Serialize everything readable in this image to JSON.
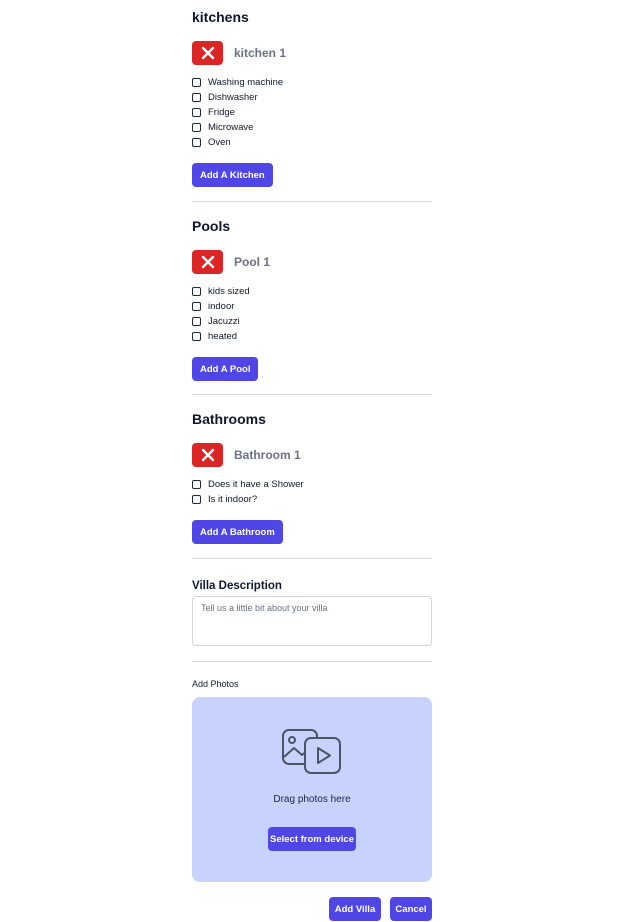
{
  "sections": {
    "kitchens": {
      "title": "kitchens",
      "item_name": "kitchen 1",
      "options": [
        "Washing machine",
        "Dishwasher",
        "Fridge",
        "Microwave",
        "Oven"
      ],
      "add_label": "Add A Kitchen"
    },
    "pools": {
      "title": "Pools",
      "item_name": "Pool 1",
      "options": [
        "kids sized",
        "indoor",
        "Jacuzzi",
        "heated"
      ],
      "add_label": "Add A Pool"
    },
    "bathrooms": {
      "title": "Bathrooms",
      "item_name": "Bathroom 1",
      "options": [
        "Does it have a Shower",
        "Is it indoor?"
      ],
      "add_label": "Add A Bathroom"
    }
  },
  "description": {
    "label": "Villa Description",
    "placeholder": "Tell us a little bit about your villa"
  },
  "photos": {
    "label": "Add Photos",
    "icon": "photo-video-icon",
    "drag_text": "Drag photos here",
    "select_label": "Select from device"
  },
  "footer": {
    "add_label": "Add Villa",
    "cancel_label": "Cancel"
  },
  "colors": {
    "accent": "#4f46e5",
    "danger": "#dc2626",
    "dropzone": "#c7d2fe"
  }
}
